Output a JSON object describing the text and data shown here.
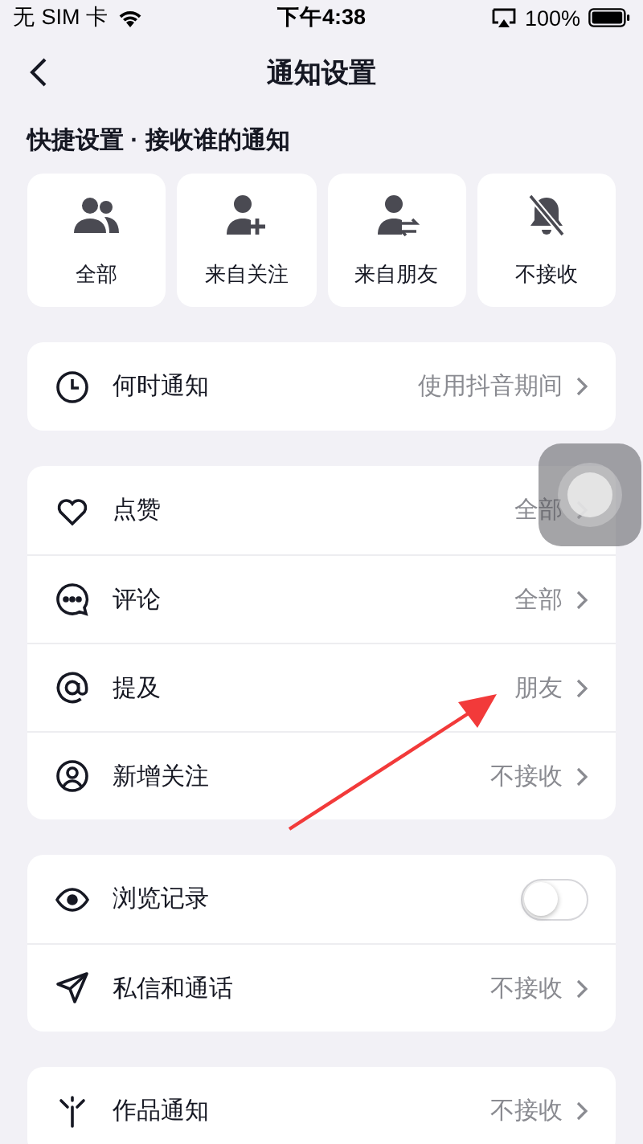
{
  "status_bar": {
    "carrier": "无 SIM 卡",
    "time": "下午4:38",
    "battery": "100%"
  },
  "nav": {
    "title": "通知设置"
  },
  "quick_settings": {
    "header": "快捷设置 · 接收谁的通知",
    "options": [
      {
        "label": "全部"
      },
      {
        "label": "来自关注"
      },
      {
        "label": "来自朋友"
      },
      {
        "label": "不接收"
      }
    ]
  },
  "cards": [
    {
      "rows": [
        {
          "kind": "link",
          "label": "何时通知",
          "value": "使用抖音期间"
        }
      ]
    },
    {
      "rows": [
        {
          "kind": "link",
          "label": "点赞",
          "value": "全部"
        },
        {
          "kind": "link",
          "label": "评论",
          "value": "全部"
        },
        {
          "kind": "link",
          "label": "提及",
          "value": "朋友"
        },
        {
          "kind": "link",
          "label": "新增关注",
          "value": "不接收"
        }
      ]
    },
    {
      "rows": [
        {
          "kind": "toggle",
          "label": "浏览记录",
          "on": false
        },
        {
          "kind": "link",
          "label": "私信和通话",
          "value": "不接收"
        }
      ]
    },
    {
      "rows": [
        {
          "kind": "link",
          "label": "作品通知",
          "value": "不接收"
        }
      ]
    }
  ]
}
